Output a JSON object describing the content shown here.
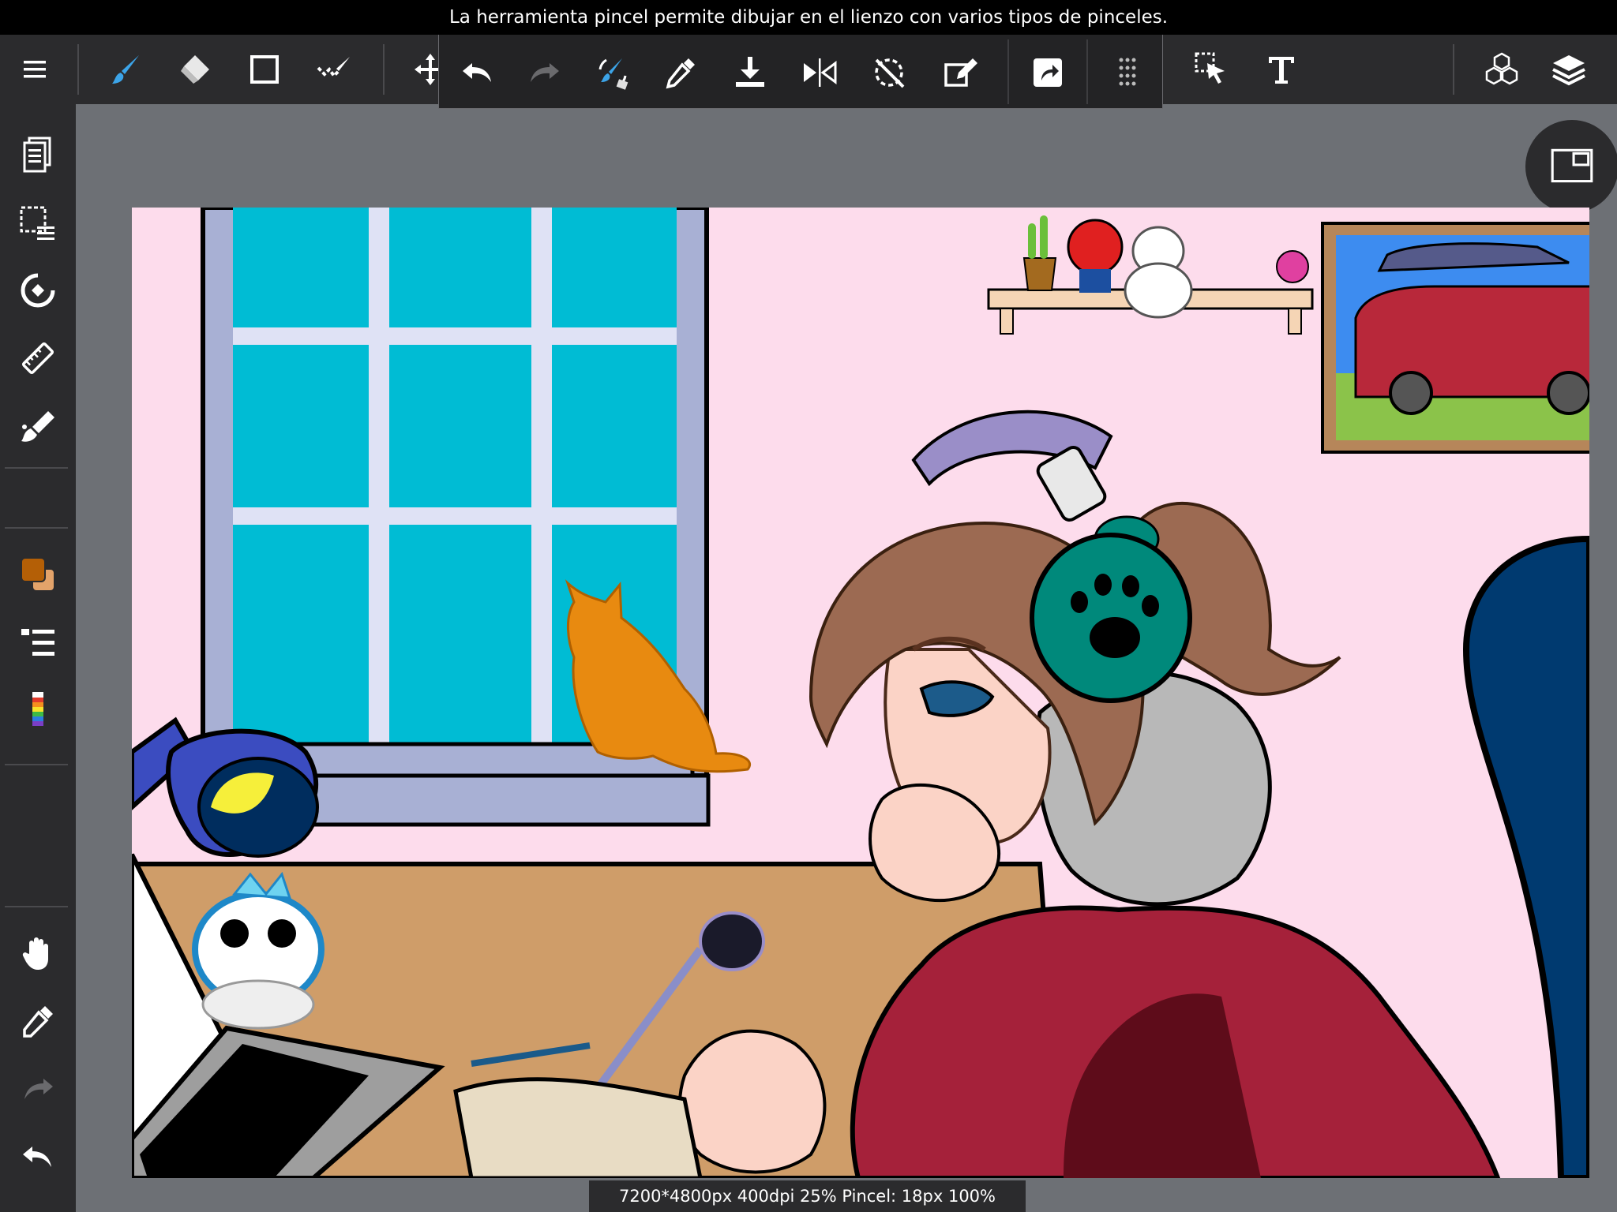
{
  "tooltip": "La herramienta pincel permite dibujar en el lienzo con varios tipos de pinceles.",
  "toolbar": {
    "menu_icon": "hamburger-menu-icon",
    "tools": [
      {
        "name": "brush-tool",
        "icon": "brush-icon",
        "active": true
      },
      {
        "name": "eraser-tool",
        "icon": "eraser-icon"
      },
      {
        "name": "shape-tool",
        "icon": "rectangle-icon"
      },
      {
        "name": "selection-pen-tool",
        "icon": "selection-pen-icon"
      },
      {
        "name": "move-tool",
        "icon": "move-icon"
      }
    ],
    "right_tools": [
      {
        "name": "select-tool",
        "icon": "cursor-select-icon"
      },
      {
        "name": "text-tool",
        "icon": "text-icon",
        "label": "T"
      },
      {
        "name": "materials",
        "icon": "cubes-icon"
      },
      {
        "name": "layers",
        "icon": "layers-icon"
      }
    ]
  },
  "quickbar": [
    {
      "name": "undo",
      "icon": "undo-icon"
    },
    {
      "name": "redo",
      "icon": "redo-icon"
    },
    {
      "name": "brush-transform",
      "icon": "brush-rotate-icon"
    },
    {
      "name": "eyedropper",
      "icon": "eyedropper-icon"
    },
    {
      "name": "save",
      "icon": "download-tray-icon"
    },
    {
      "name": "flip",
      "icon": "flip-horizontal-icon"
    },
    {
      "name": "rotate-reset",
      "icon": "rotate-off-icon"
    },
    {
      "name": "edit-selection",
      "icon": "pencil-square-icon"
    },
    {
      "name": "share",
      "icon": "share-arrow-icon"
    },
    {
      "name": "more",
      "icon": "grip-dots-icon"
    }
  ],
  "sidebar": [
    {
      "name": "pages",
      "icon": "pages-icon"
    },
    {
      "name": "selection-menu",
      "icon": "selection-list-icon"
    },
    {
      "name": "snap",
      "icon": "snap-rotate-icon"
    },
    {
      "name": "ruler",
      "icon": "ruler-icon"
    },
    {
      "name": "fill",
      "icon": "fill-brush-icon"
    },
    {
      "name": "colors",
      "icon": "color-swatch-icon"
    },
    {
      "name": "brush-list",
      "icon": "brush-list-icon"
    },
    {
      "name": "color-palette",
      "icon": "rainbow-palette-icon"
    },
    {
      "name": "hand",
      "icon": "hand-icon"
    },
    {
      "name": "dropper",
      "icon": "eyedropper-icon"
    },
    {
      "name": "redo",
      "icon": "redo-icon"
    },
    {
      "name": "undo",
      "icon": "undo-icon"
    }
  ],
  "colors": {
    "primary": "#b45f06",
    "secondary": "#e3a36a",
    "panel": "#2b2b2d",
    "workspace": "#6d7075",
    "brush_active": "#3ca4e8",
    "canvas_wall": "#fddcec"
  },
  "status": "7200*4800px 400dpi 25% Pincel: 18px 100%"
}
